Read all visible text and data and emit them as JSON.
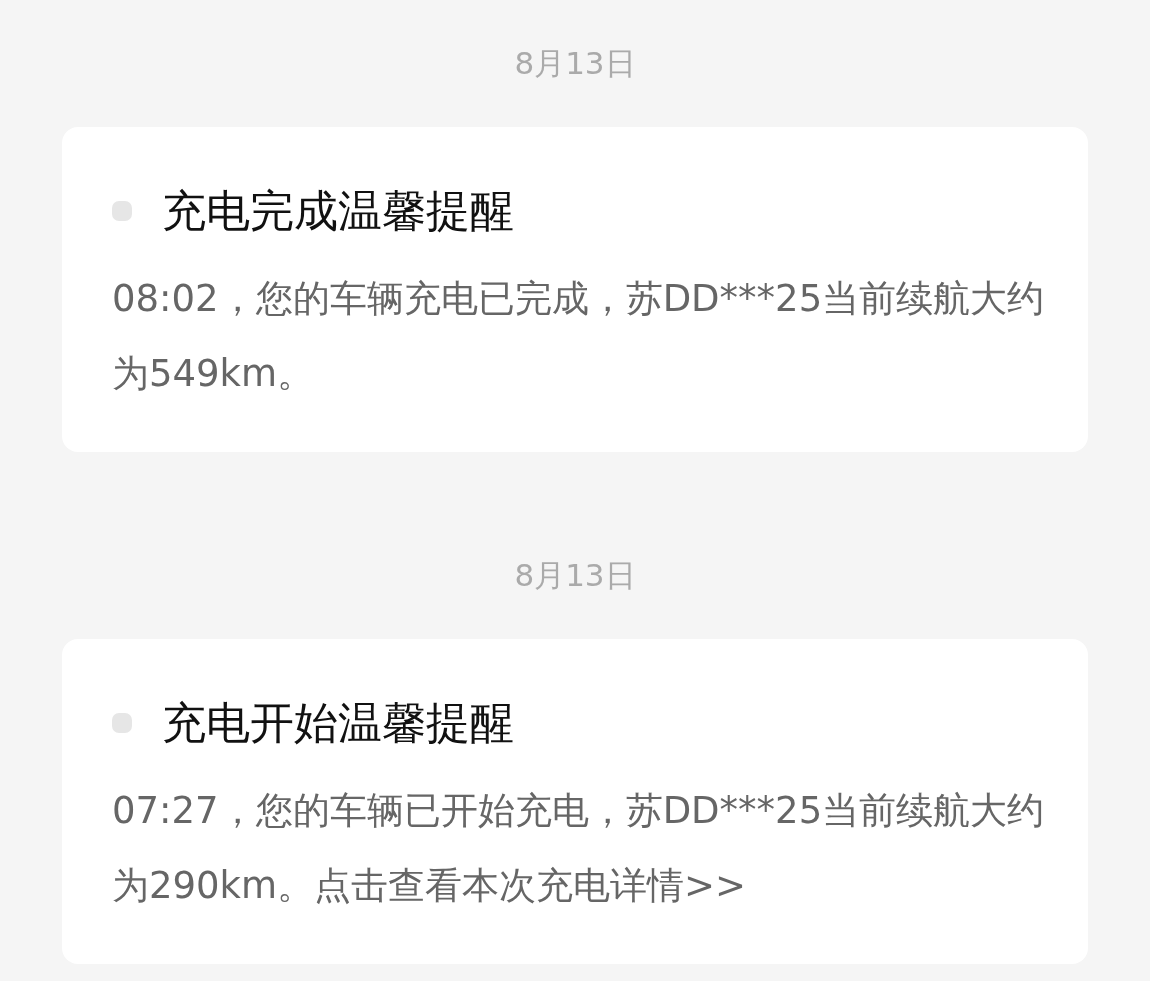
{
  "messages": [
    {
      "date": "8月13日",
      "title": "充电完成温馨提醒",
      "body": "08:02，您的车辆充电已完成，苏DD***25当前续航大约为549km。"
    },
    {
      "date": "8月13日",
      "title": "充电开始温馨提醒",
      "body": "07:27，您的车辆已开始充电，苏DD***25当前续航大约为290km。",
      "link": "点击查看本次充电详情>>"
    }
  ]
}
